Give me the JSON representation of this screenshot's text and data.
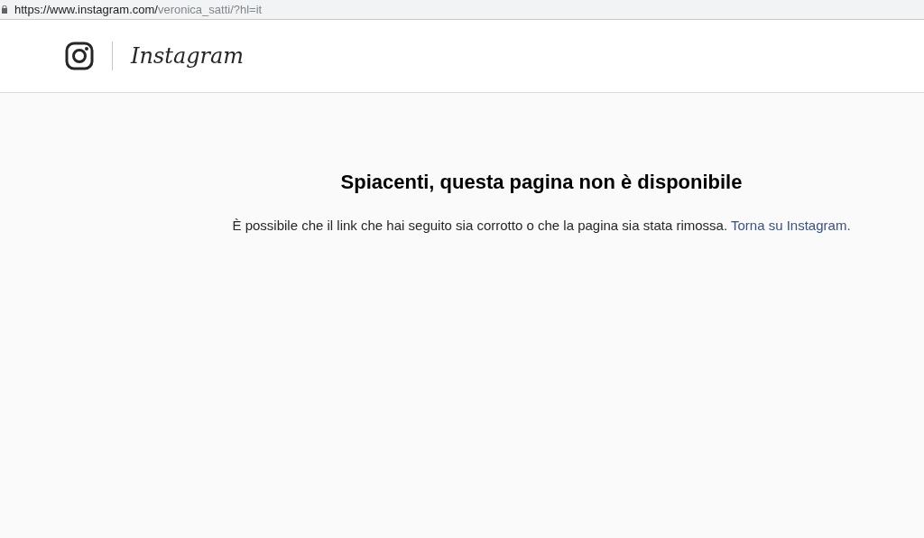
{
  "address_bar": {
    "host": "https://www.instagram.com/",
    "path": "veronica_satti/?hl=it"
  },
  "header": {
    "logo_text": "Instagram"
  },
  "error": {
    "title": "Spiacenti, questa pagina non è disponibile",
    "message": "È possibile che il link che hai seguito sia corrotto o che la pagina sia stata rimossa.",
    "link": "Torna su Instagram."
  }
}
